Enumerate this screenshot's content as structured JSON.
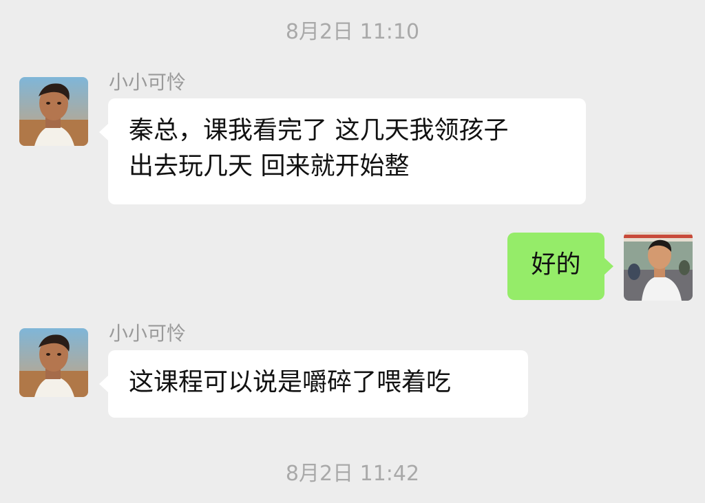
{
  "timestamps": [
    "8月2日 11:10",
    "8月2日 11:42"
  ],
  "messages": [
    {
      "sender": "小小可怜",
      "direction": "incoming",
      "lines": [
        "秦总，课我看完了 这几天我领孩子",
        "出去玩几天 回来就开始整"
      ]
    },
    {
      "sender": "",
      "direction": "outgoing",
      "text": "好的"
    },
    {
      "sender": "小小可怜",
      "direction": "incoming",
      "text": "这课程可以说是嚼碎了喂着吃"
    }
  ],
  "colors": {
    "background": "#ededed",
    "incoming_bubble": "#ffffff",
    "outgoing_bubble": "#95ec69",
    "timestamp_text": "#a9a9a9",
    "name_text": "#9a9a9a"
  }
}
